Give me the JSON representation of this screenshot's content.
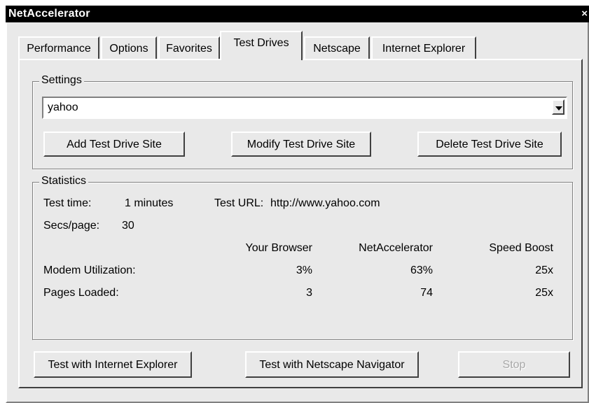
{
  "window": {
    "title": "NetAccelerator",
    "close_icon": "×"
  },
  "tabs": [
    {
      "label": "Performance"
    },
    {
      "label": "Options"
    },
    {
      "label": "Favorites"
    },
    {
      "label": "Test Drives"
    },
    {
      "label": "Netscape"
    },
    {
      "label": "Internet Explorer"
    }
  ],
  "active_tab": "Test Drives",
  "settings": {
    "label": "Settings",
    "site_select": {
      "value": "yahoo"
    },
    "add_button": "Add Test Drive Site",
    "modify_button": "Modify Test Drive Site",
    "delete_button": "Delete Test Drive Site"
  },
  "statistics": {
    "label": "Statistics",
    "test_time_label": "Test time:",
    "test_time_value": "1 minutes",
    "test_url_label": "Test URL:",
    "test_url_value": "http://www.yahoo.com",
    "secs_per_page_label": "Secs/page:",
    "secs_per_page_value": "30",
    "columns": [
      "Your Browser",
      "NetAccelerator",
      "Speed Boost"
    ],
    "rows": [
      {
        "label": "Modem Utilization:",
        "values": [
          "3%",
          "63%",
          "25x"
        ]
      },
      {
        "label": "Pages Loaded:",
        "values": [
          "3",
          "74",
          "25x"
        ]
      }
    ]
  },
  "actions": {
    "test_ie_button": "Test with Internet Explorer",
    "test_netscape_button": "Test with Netscape Navigator",
    "stop_button": "Stop"
  }
}
